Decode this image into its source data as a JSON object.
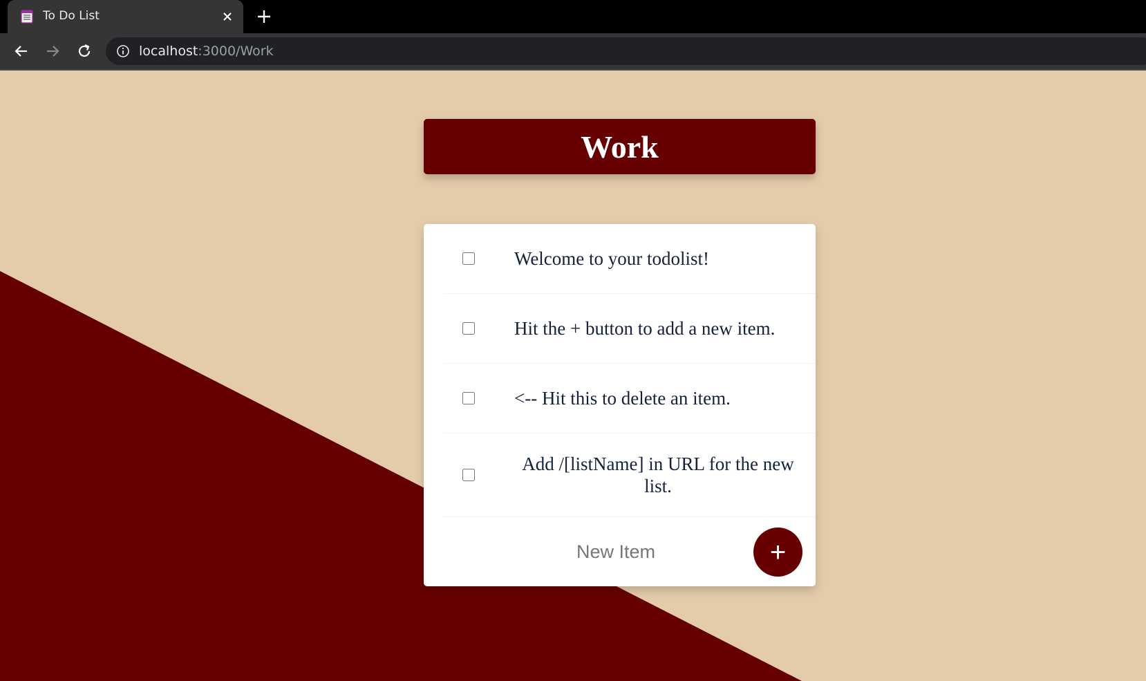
{
  "browser": {
    "tab_title": "To Do List",
    "url_host": "localhost",
    "url_rest": ":3000/Work",
    "icons": {
      "tab": "notepad-icon",
      "close": "close-icon",
      "new_tab": "plus-icon",
      "back": "back-arrow-icon",
      "forward": "forward-arrow-icon",
      "reload": "reload-icon",
      "info": "info-icon"
    }
  },
  "page": {
    "colors": {
      "background": "#e4ccaa",
      "accent": "#660000",
      "card": "#ffffff",
      "item_text": "#14223c"
    },
    "list_title": "Work",
    "items": [
      {
        "text": "Welcome to your todolist!",
        "checked": false
      },
      {
        "text": "Hit the + button to add a new item.",
        "checked": false
      },
      {
        "text": "<-- Hit this to delete an item.",
        "checked": false
      },
      {
        "text": "Add /[listName] in URL for the new list.",
        "checked": false
      }
    ],
    "new_item": {
      "placeholder": "New Item",
      "button_label": "+"
    }
  }
}
